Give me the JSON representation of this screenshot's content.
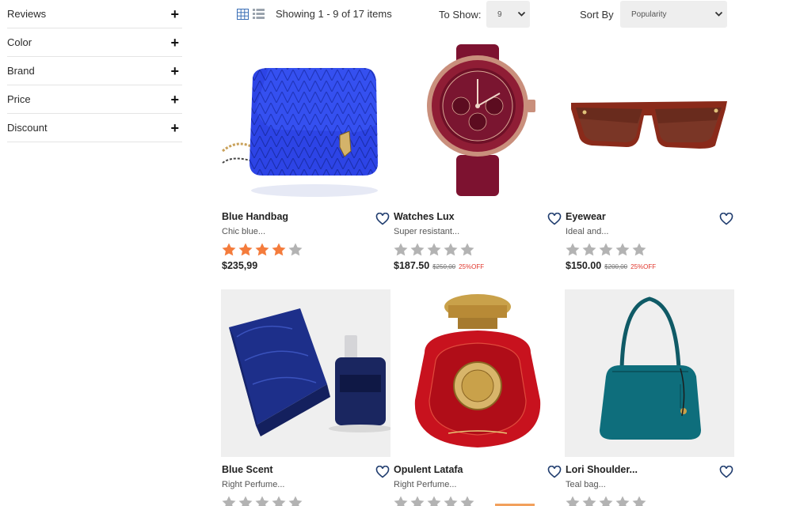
{
  "sidebar": {
    "filters": [
      {
        "label": "Reviews"
      },
      {
        "label": "Color"
      },
      {
        "label": "Brand"
      },
      {
        "label": "Price"
      },
      {
        "label": "Discount"
      }
    ],
    "expand_symbol": "+"
  },
  "toolbar": {
    "showing_text": "Showing 1 - 9 of 17 items",
    "to_show_label": "To Show:",
    "to_show_value": "9",
    "sort_label": "Sort By",
    "sort_value": "Popularity"
  },
  "products": [
    {
      "name": "Blue Handbag",
      "desc": "Chic blue...",
      "rating": 4,
      "price": "$235,99",
      "old_price": "",
      "discount": ""
    },
    {
      "name": "Watches Lux",
      "desc": "Super resistant...",
      "rating": 0,
      "price": "$187.50",
      "old_price": "$250,00",
      "discount": "25%OFF"
    },
    {
      "name": "Eyewear",
      "desc": "Ideal and...",
      "rating": 0,
      "price": "$150.00",
      "old_price": "$200,00",
      "discount": "25%OFF"
    },
    {
      "name": "Blue Scent",
      "desc": "Right Perfume...",
      "rating": 0,
      "price": "",
      "old_price": "",
      "discount": ""
    },
    {
      "name": "Opulent Latafa",
      "desc": "Right Perfume...",
      "rating": 0,
      "price": "",
      "old_price": "",
      "discount": ""
    },
    {
      "name": "Lori Shoulder...",
      "desc": "Teal bag...",
      "rating": 0,
      "price": "",
      "old_price": "",
      "discount": ""
    }
  ],
  "colors": {
    "star_filled": "#f47c3c",
    "star_empty": "#b3b3b3",
    "discount": "#e0362c",
    "grid_icon_active": "#3b6fb6",
    "list_icon": "#9aa3ad"
  },
  "icons": {
    "grid_view": "grid-view-icon",
    "list_view": "list-view-icon",
    "wishlist": "heart-icon",
    "expand": "plus-icon",
    "dropdown": "chevron-down-icon",
    "rating": "star-icon"
  }
}
